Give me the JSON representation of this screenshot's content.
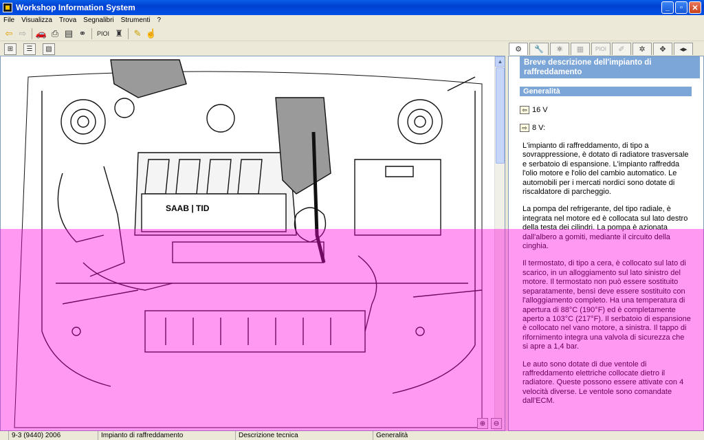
{
  "window": {
    "title": "Workshop Information System"
  },
  "menu": [
    "File",
    "Visualizza",
    "Trova",
    "Segnalibri",
    "Strumenti",
    "?"
  ],
  "toolbar": {
    "pioi_label": "PIOI"
  },
  "righttabs": {
    "pioi_label": "PIOI"
  },
  "doc": {
    "heading": "Breve descrizione dell'impianto di raffreddamento",
    "section": "Generalità",
    "link_16v": "16 V",
    "link_8v": "8 V:",
    "paragraphs": [
      "L'impianto di raffreddamento, di tipo a sovrappressione, è dotato di radiatore trasversale e serbatoio di espansione. L'impianto raffredda l'olio motore e l'olio del cambio automatico. Le automobili per i mercati nordici sono dotate di riscaldatore di parcheggio.",
      "La pompa del refrigerante, del tipo radiale, è integrata nel motore ed è collocata sul lato destro della testa dei cilindri. La pompa è azionata dall'albero a gomiti, mediante il circuito della cinghia.",
      "Il termostato, di tipo a cera, è collocato sul lato di scarico, in un alloggiamento sul lato sinistro del motore. Il termostato non può essere sostituito separatamente, bensì deve essere sostituito con l'alloggiamento completo. Ha una temperatura di apertura di 88°C (190°F) ed è completamente aperto a 103°C (217°F). Il serbatoio di espansione è collocato nel vano motore, a sinistra. Il tappo di rifornimento integra una valvola di sicurezza che si apre a 1,4 bar.",
      "Le auto sono dotate di due ventole di raffreddamento elettriche collocate dietro il radiatore. Queste possono essere attivate con 4 velocità diverse. Le ventole sono comandate dall'ECM."
    ]
  },
  "image": {
    "brand_text": "SAAB | TID"
  },
  "status": {
    "model": "9-3 (9440) 2006",
    "system": "Impianto di raffreddamento",
    "doctype": "Descrizione tecnica",
    "section": "Generalità"
  }
}
